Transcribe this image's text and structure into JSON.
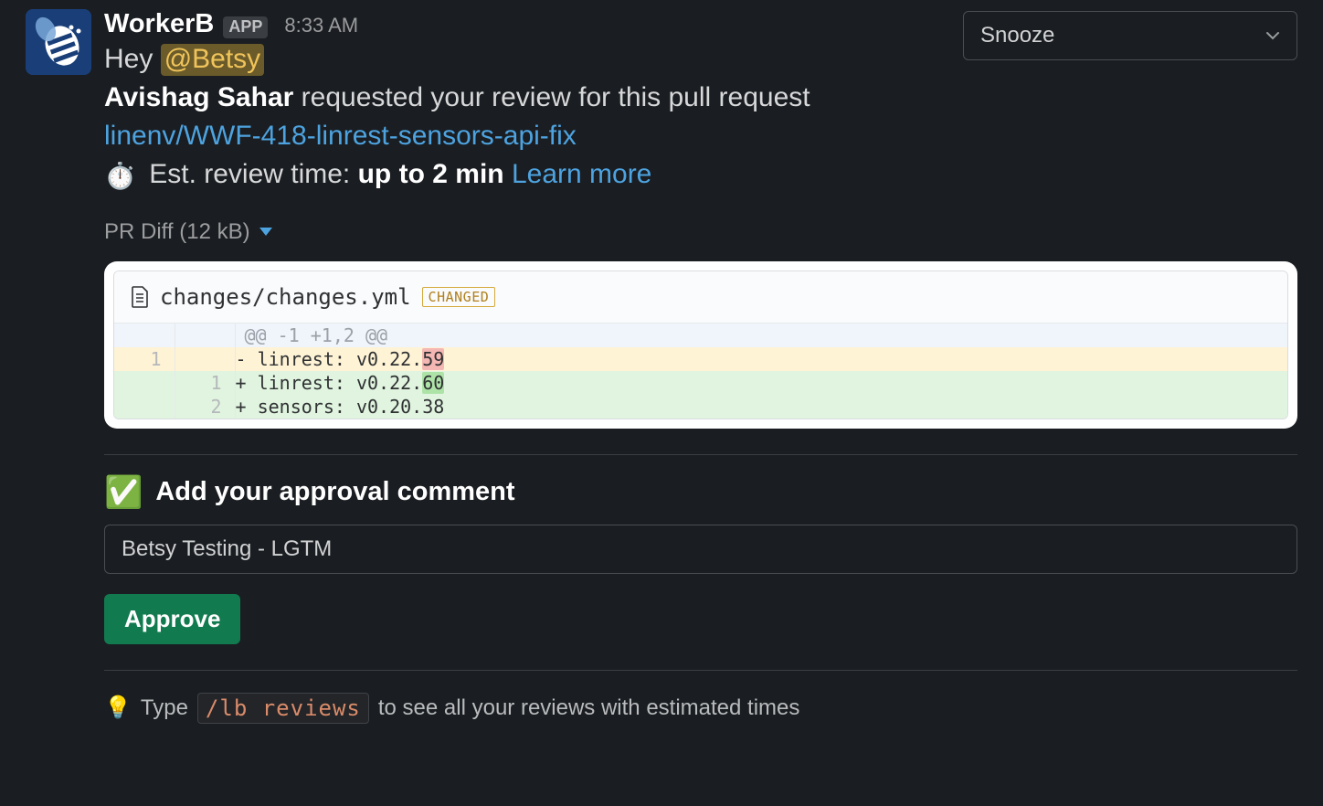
{
  "sender": {
    "name": "WorkerB",
    "badge": "APP",
    "timestamp": "8:33 AM"
  },
  "greeting": {
    "prefix": "Hey ",
    "mention": "@Betsy"
  },
  "request": {
    "author": "Avishag Sahar",
    "text": " requested your review for this pull request"
  },
  "pr_link": "linenv/WWF-418-linrest-sensors-api-fix",
  "review_time": {
    "icon": "⏱️",
    "label": "Est. review time: ",
    "value": "up to 2 min",
    "learn_more": "Learn more"
  },
  "snooze": {
    "label": "Snooze"
  },
  "diff": {
    "toggle_label": "PR Diff (12 kB)",
    "filename": "changes/changes.yml",
    "changed_badge": "CHANGED",
    "hunk": "@@ -1 +1,2 @@",
    "rows": [
      {
        "old": "1",
        "new": "",
        "prefix": "- ",
        "text_a": "linrest: v0.22.",
        "hl": "59",
        "text_b": "",
        "kind": "del"
      },
      {
        "old": "",
        "new": "1",
        "prefix": "+ ",
        "text_a": "linrest: v0.22.",
        "hl": "60",
        "text_b": "",
        "kind": "add"
      },
      {
        "old": "",
        "new": "2",
        "prefix": "+ ",
        "text_a": "sensors: v0.20.38",
        "hl": "",
        "text_b": "",
        "kind": "add"
      }
    ]
  },
  "approval": {
    "icon": "✅",
    "title": "Add your approval comment",
    "input_value": "Betsy Testing - LGTM",
    "approve_label": "Approve"
  },
  "footer": {
    "icon": "💡",
    "prefix": "Type ",
    "command": "/lb reviews",
    "suffix": " to see all your reviews with estimated times"
  }
}
